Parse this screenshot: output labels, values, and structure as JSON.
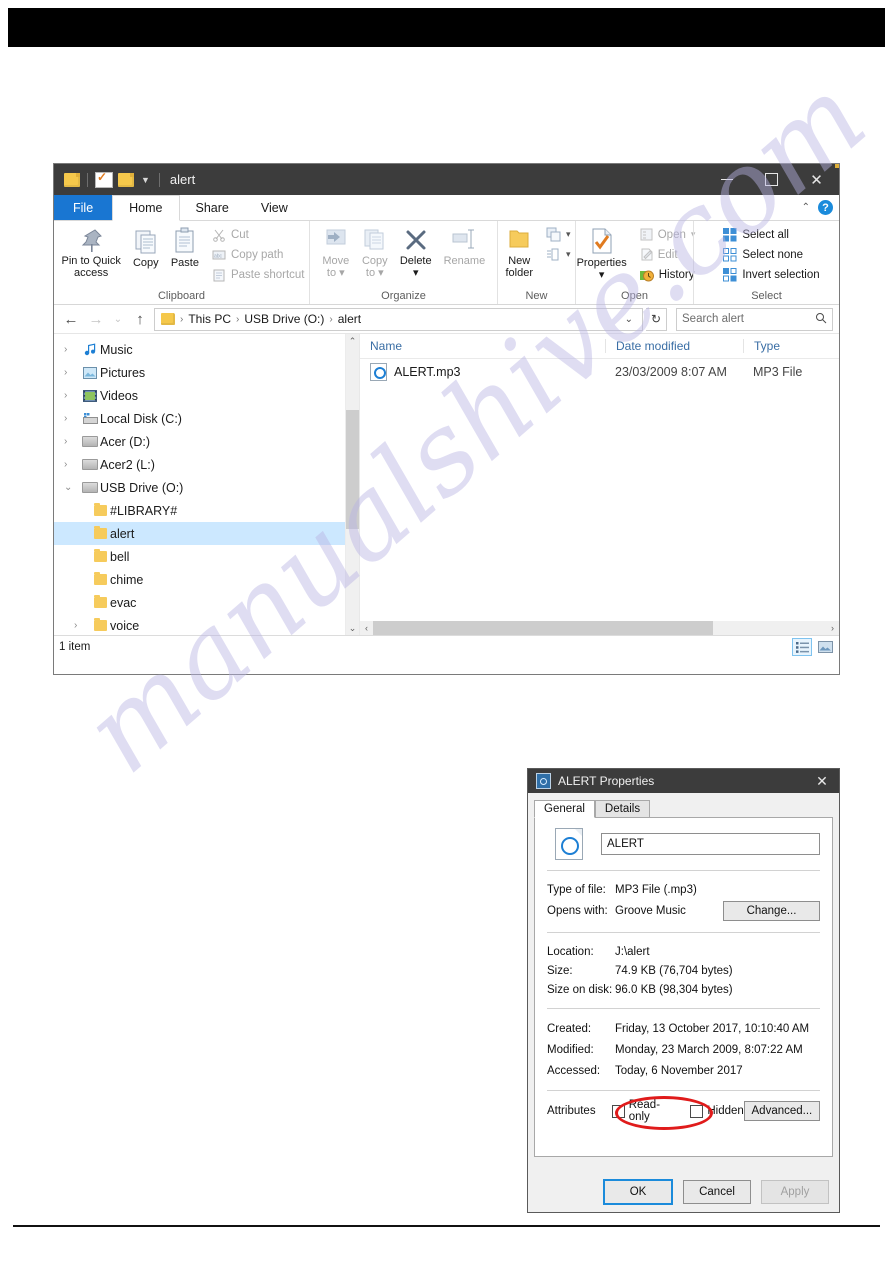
{
  "explorer": {
    "title": "alert",
    "quick_access": [
      "folder-icon",
      "properties-icon",
      "new-folder-icon",
      "customize-caret-icon"
    ],
    "window_buttons": {
      "minimize": "minimize-icon",
      "maximize": "maximize-icon",
      "close": "close-icon"
    },
    "tabs": [
      {
        "label": "File",
        "id": "file"
      },
      {
        "label": "Home",
        "id": "home"
      },
      {
        "label": "Share",
        "id": "share"
      },
      {
        "label": "View",
        "id": "view"
      }
    ],
    "active_tab": "Home",
    "ribbon": {
      "groups": [
        {
          "label": "Clipboard",
          "big": [
            {
              "label": "Pin to Quick\naccess",
              "line1": "Pin to Quick",
              "line2": "access",
              "disabled": false
            },
            {
              "label": "Copy",
              "line1": "Copy",
              "line2": "",
              "disabled": false
            },
            {
              "label": "Paste",
              "line1": "Paste",
              "line2": "",
              "disabled": false
            }
          ],
          "small": [
            {
              "label": "Cut",
              "disabled": true
            },
            {
              "label": "Copy path",
              "disabled": true
            },
            {
              "label": "Paste shortcut",
              "disabled": true
            }
          ]
        },
        {
          "label": "Organize",
          "big": [
            {
              "line1": "Move",
              "line2": "to",
              "disabled": true
            },
            {
              "line1": "Copy",
              "line2": "to",
              "disabled": true
            },
            {
              "line1": "Delete",
              "line2": "",
              "disabled": false
            },
            {
              "line1": "Rename",
              "line2": "",
              "disabled": true
            }
          ],
          "small": []
        },
        {
          "label": "New",
          "big": [
            {
              "line1": "New",
              "line2": "folder",
              "disabled": false
            }
          ],
          "small": []
        },
        {
          "label": "Open",
          "big": [
            {
              "line1": "Properties",
              "line2": "",
              "disabled": false
            }
          ],
          "small": [
            {
              "label": "Open",
              "disabled": true
            },
            {
              "label": "Edit",
              "disabled": true
            },
            {
              "label": "History",
              "disabled": false
            }
          ]
        },
        {
          "label": "Select",
          "big": [],
          "small": [
            {
              "label": "Select all",
              "disabled": false
            },
            {
              "label": "Select none",
              "disabled": false
            },
            {
              "label": "Invert selection",
              "disabled": false
            }
          ]
        }
      ]
    },
    "address": {
      "crumbs": [
        "This PC",
        "USB Drive (O:)",
        "alert"
      ],
      "separator": "›"
    },
    "search": {
      "placeholder": "Search alert",
      "value": ""
    },
    "nav_tree": [
      {
        "label": "Music",
        "icon": "music-icon",
        "indent": 0,
        "chevron": "›",
        "selected": false
      },
      {
        "label": "Pictures",
        "icon": "pictures-icon",
        "indent": 0,
        "chevron": "›",
        "selected": false
      },
      {
        "label": "Videos",
        "icon": "videos-icon",
        "indent": 0,
        "chevron": "›",
        "selected": false
      },
      {
        "label": "Local Disk (C:)",
        "icon": "drive-icon",
        "indent": 0,
        "chevron": "›",
        "selected": false
      },
      {
        "label": "Acer (D:)",
        "icon": "drive-icon",
        "indent": 0,
        "chevron": "›",
        "selected": false
      },
      {
        "label": "Acer2 (L:)",
        "icon": "drive-icon",
        "indent": 0,
        "chevron": "›",
        "selected": false
      },
      {
        "label": "USB Drive (O:)",
        "icon": "drive-icon",
        "indent": 0,
        "chevron": "⌄",
        "selected": false
      },
      {
        "label": "#LIBRARY#",
        "icon": "folder-icon",
        "indent": 1,
        "chevron": "",
        "selected": false
      },
      {
        "label": "alert",
        "icon": "folder-icon",
        "indent": 1,
        "chevron": "",
        "selected": true
      },
      {
        "label": "bell",
        "icon": "folder-icon",
        "indent": 1,
        "chevron": "",
        "selected": false
      },
      {
        "label": "chime",
        "icon": "folder-icon",
        "indent": 1,
        "chevron": "",
        "selected": false
      },
      {
        "label": "evac",
        "icon": "folder-icon",
        "indent": 1,
        "chevron": "",
        "selected": false
      },
      {
        "label": "voice",
        "icon": "folder-icon",
        "indent": 1,
        "chevron": "›",
        "selected": false
      }
    ],
    "columns": [
      "Name",
      "Date modified",
      "Type"
    ],
    "files": [
      {
        "name": "ALERT.mp3",
        "date_modified": "23/03/2009 8:07 AM",
        "type": "MP3 File",
        "icon": "mp3-file-icon"
      }
    ],
    "status": {
      "item_count": "1 item",
      "view_details": "details-view-icon",
      "view_large": "large-icons-view-icon"
    }
  },
  "properties_dialog": {
    "title": "ALERT Properties",
    "close": "✕",
    "tabs": [
      {
        "label": "General",
        "active": true
      },
      {
        "label": "Details",
        "active": false
      }
    ],
    "filename": "ALERT",
    "fields": [
      {
        "key": "Type of file:",
        "value": "MP3 File (.mp3)"
      },
      {
        "key": "Opens with:",
        "value": "Groove Music",
        "button": "Change..."
      },
      {
        "key": "Location:",
        "value": "J:\\alert"
      },
      {
        "key": "Size:",
        "value": "74.9 KB (76,704 bytes)"
      },
      {
        "key": "Size on disk:",
        "value": "96.0 KB (98,304 bytes)"
      },
      {
        "key": "Created:",
        "value": "Friday, 13 October 2017, 10:10:40 AM"
      },
      {
        "key": "Modified:",
        "value": "Monday, 23 March 2009, 8:07:22 AM"
      },
      {
        "key": "Accessed:",
        "value": "Today, 6 November 2017"
      }
    ],
    "attributes": {
      "label": "Attributes",
      "readonly": {
        "label": "Read-only",
        "checked": false
      },
      "hidden": {
        "label": "Hidden",
        "checked": false
      },
      "advanced_button": "Advanced..."
    },
    "footer": {
      "ok": "OK",
      "cancel": "Cancel",
      "apply": "Apply"
    }
  },
  "annotation": {
    "highlight_color": "#e01b1b",
    "target": "Read-only"
  },
  "watermark": {
    "text": "manualshive.com",
    "color": "#b9b4e4"
  }
}
